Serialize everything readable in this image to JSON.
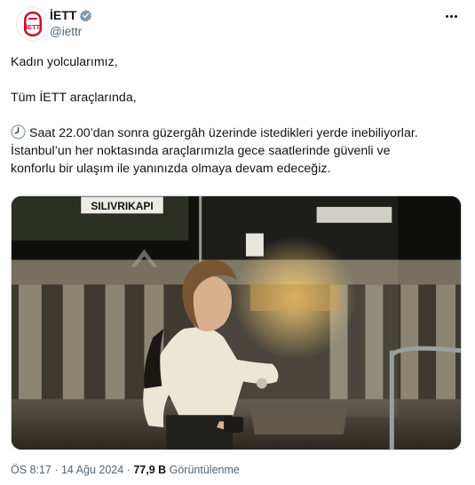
{
  "account": {
    "display_name": "İETT",
    "handle": "@iettr",
    "avatar_icon": "iett-logo-icon",
    "verified_icon": "verified-badge-icon",
    "verified_color": "#829aab"
  },
  "more_icon": "more-options-icon",
  "tweet": {
    "line1": "Kadın yolcularımız,",
    "line2": "Tüm İETT araçlarında,",
    "clock_icon": "clock-emoji-icon",
    "line3": "Saat 22.00’dan sonra güzergâh üzerinde istedikleri yerde inebiliyorlar.\nİstanbul’un her noktasında araçlarımızla gece saatlerinde güvenli ve\nkonforlu bir ulaşım ile yanınızda olmaya devam edeceğiz."
  },
  "media": {
    "sign_text": "SILIVRIKAPI"
  },
  "footer": {
    "time": "ÖS 8:17",
    "sep1": " · ",
    "date": "14 Ağu 2024",
    "sep2": " · ",
    "views": "77,9 B",
    "views_label": " Görüntülenme"
  }
}
